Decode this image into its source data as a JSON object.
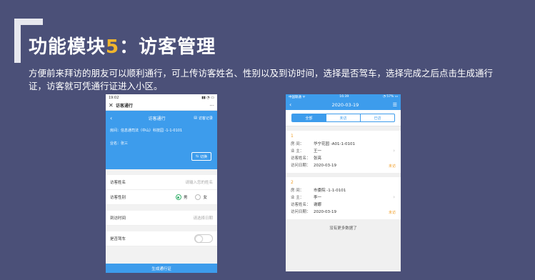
{
  "slide": {
    "title_prefix": "功能模块",
    "title_num": "5",
    "title_suffix": "：访客管理",
    "description": "方便前来拜访的朋友可以顺利通行，可上传访客姓名、性别以及到访时间，选择是否驾车，选择完成之后点击生成通行证，访客就可凭通行证进入小区。"
  },
  "phone1": {
    "status_time": "19:02",
    "status_icons": "▮▮ ◔ ▭",
    "nav_back": "✕",
    "nav_title": "访客通行",
    "nav_more": "···",
    "header": {
      "back": "‹",
      "title": "访客通行",
      "record_label": "访客记录",
      "record_icon": "▤",
      "address_label": "房间：",
      "address_value": "信息通司法（中山）科技园 -1-1-0101",
      "name_label": "业名：",
      "name_value": "张三",
      "switch_icon": "⇆",
      "switch_label": "切换"
    },
    "form": {
      "name_label": "访客姓名",
      "name_placeholder": "请输入您的姓名",
      "gender_label": "访客性别",
      "gender_male": "男",
      "gender_female": "女",
      "time_label": "到访时间",
      "time_placeholder": "请选择日期",
      "drive_label": "是否驾车",
      "drive_on": false
    },
    "submit_label": "生成通行证",
    "colors": {
      "accent": "#3d9cec",
      "radio_on": "#36b06c"
    }
  },
  "phone2": {
    "status_left": "中国联通 ᯤ",
    "status_time": "16:39",
    "status_right": "◔ 57% ▭",
    "nav_back": "‹",
    "nav_title": "2020-03-19",
    "nav_menu": "☰",
    "tabs": [
      {
        "label": "全部",
        "active": true
      },
      {
        "label": "未访",
        "active": false
      },
      {
        "label": "已访",
        "active": false
      }
    ],
    "records": [
      {
        "index": "1",
        "room_label": "房    间：",
        "room": "华宁花园 -A01-1-0101",
        "owner_label": "业    主：",
        "owner": "王一",
        "visitor_label": "访客姓名：",
        "visitor": "张亮",
        "date_label": "访问日期：",
        "date": "2020-03-19",
        "status": "未访"
      },
      {
        "index": "2",
        "room_label": "房    间：",
        "room": "市委院 -1-1-0101",
        "owner_label": "业    主：",
        "owner": "李一",
        "visitor_label": "访客姓名：",
        "visitor": "谢娜",
        "date_label": "访问日期：",
        "date": "2020-03-19",
        "status": "未访"
      }
    ],
    "no_more": "没有更多数据了",
    "colors": {
      "accent": "#3d9cec",
      "status": "#f1a02b"
    }
  }
}
